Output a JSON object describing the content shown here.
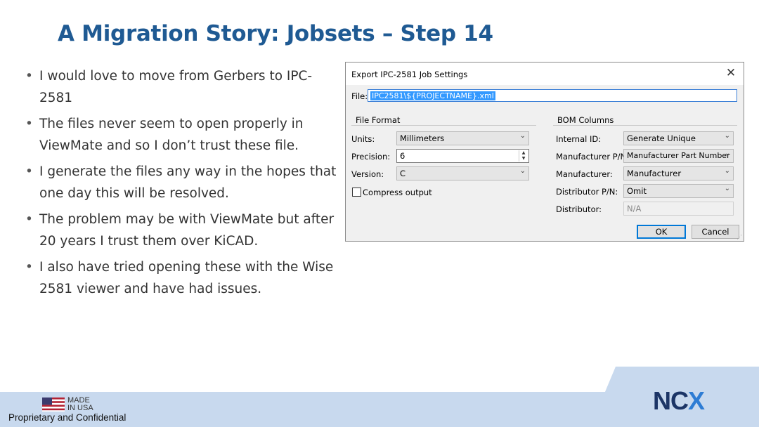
{
  "slide": {
    "title": "A Migration Story: Jobsets – Step 14",
    "bullets": [
      "I would love to move from Gerbers to IPC-2581",
      "The files never seem to open properly in ViewMate and so I don’t trust these file.",
      "I generate the files any way in the hopes that one day this will be resolved.",
      "The problem may be with ViewMate but after 20 years I trust them over KiCAD.",
      "I also have tried opening these with the Wise 2581 viewer and have had issues."
    ]
  },
  "dialog": {
    "title": "Export IPC-2581 Job Settings",
    "close_glyph": "✕",
    "file_label": "File:",
    "file_value": "IPC2581\\${PROJECTNAME}.xml",
    "file_format": {
      "heading": "File Format",
      "units_label": "Units:",
      "units_value": "Millimeters",
      "precision_label": "Precision:",
      "precision_value": "6",
      "version_label": "Version:",
      "version_value": "C",
      "compress_label": "Compress output",
      "compress_checked": false
    },
    "bom": {
      "heading": "BOM Columns",
      "internal_id_label": "Internal ID:",
      "internal_id_value": "Generate Unique",
      "mpn_label": "Manufacturer P/N:",
      "mpn_value": "Manufacturer Part Number",
      "manufacturer_label": "Manufacturer:",
      "manufacturer_value": "Manufacturer",
      "dpn_label": "Distributor P/N:",
      "dpn_value": "Omit",
      "distributor_label": "Distributor:",
      "distributor_value": "N/A"
    },
    "ok_label": "OK",
    "cancel_label": "Cancel"
  },
  "footer": {
    "made_line1": "MADE",
    "made_line2": "IN USA",
    "confidential": "Proprietary and Confidential",
    "logo_left": "NC",
    "logo_x": "X"
  },
  "colors": {
    "title": "#1f5a93",
    "footer_band": "#c8d9ee",
    "logo_dark": "#1c3566",
    "logo_accent": "#2d7cd4"
  }
}
